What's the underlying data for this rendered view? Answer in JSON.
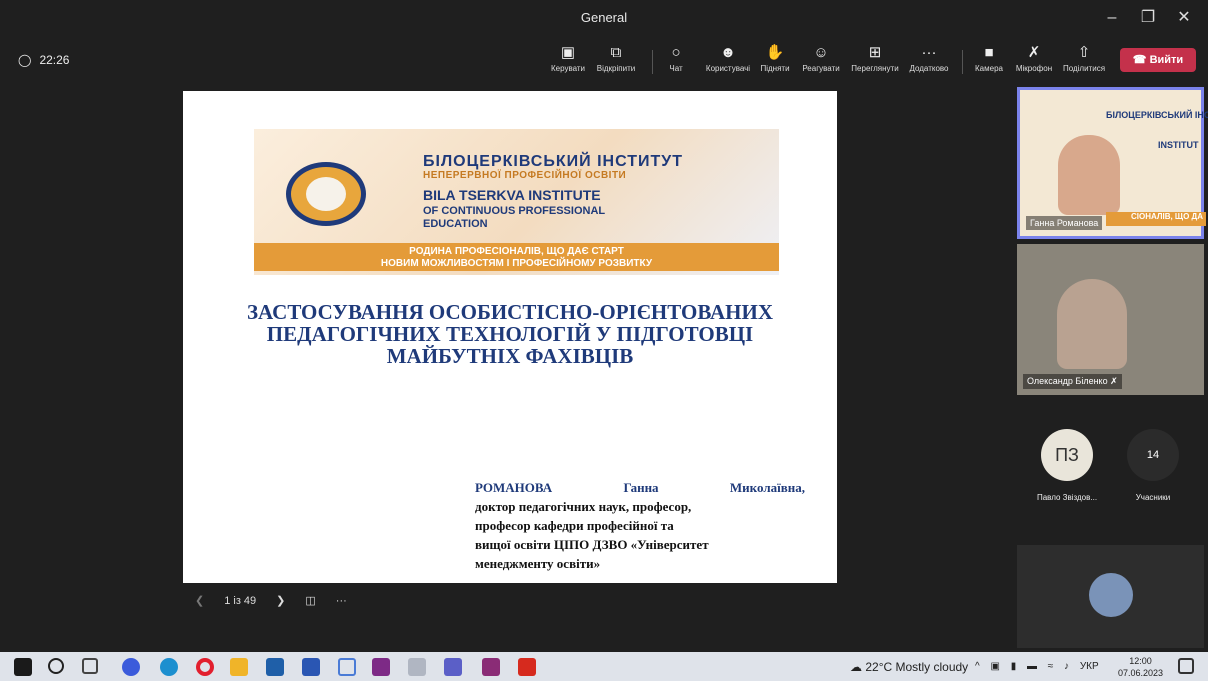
{
  "window": {
    "title": "General"
  },
  "meeting": {
    "timer": "22:26"
  },
  "toolbar": {
    "manage": "Керувати",
    "popout": "Відкріпити",
    "chat": "Чат",
    "users": "Користувачі",
    "raise": "Підняти",
    "react": "Реагувати",
    "view": "Переглянути",
    "more": "Додатково",
    "camera": "Камера",
    "mic": "Мікрофон",
    "share": "Поділитися",
    "leave": "Вийти"
  },
  "slide": {
    "banner": {
      "line1": "БІЛОЦЕРКІВСЬКИЙ ІНСТИТУТ",
      "line2": "НЕПЕРЕРВНОЇ ПРОФЕСІЙНОЇ ОСВІТИ",
      "line3": "BILA TSERKVA INSTITUTE",
      "line4": "OF CONTINUOUS PROFESSIONAL",
      "line5": "EDUCATION",
      "slogan1": "РОДИНА ПРОФЕСІОНАЛІВ, ЩО ДАЄ СТАРТ",
      "slogan2": "НОВИМ МОЖЛИВОСТЯМ І ПРОФЕСІЙНОМУ РОЗВИТКУ"
    },
    "heading1": "ЗАСТОСУВАННЯ ОСОБИСТІСНО-ОРІЄНТОВАНИХ",
    "heading2": "ПЕДАГОГІЧНИХ ТЕХНОЛОГІЙ У ПІДГОТОВЦІ",
    "heading3": "МАЙБУТНІХ ФАХІВЦІВ",
    "author_surname": "РОМАНОВА",
    "author_name": "Ганна",
    "author_patronymic": "Миколаївна,",
    "author_line2": "доктор педагогічних наук, професор,",
    "author_line3": "професор кафедри професійної та",
    "author_line4": "вищої освіти ЦІПО ДЗВО «Університет",
    "author_line5": "менеджменту освіти»"
  },
  "pager": {
    "label": "1 із 49"
  },
  "participants": {
    "p1": "Ганна Романова",
    "p2": "Олександр Біленко",
    "p3_initials": "ПЗ",
    "p3_name": "Павло Звіздов...",
    "count": "14",
    "count_label": "Учасники",
    "tile1_text1": "БІЛОЦЕРКІВСЬКИЙ ІНСТІ",
    "tile1_text2": "INSTITUT",
    "tile1_text3": "СІОНАЛІВ, ЩО ДА"
  },
  "taskbar": {
    "weather": "22°C  Mostly cloudy",
    "lang": "УКР",
    "time": "12:00",
    "date": "07.06.2023"
  },
  "colors": {
    "accent": "#c4314b",
    "slide_blue": "#1f3a7a",
    "banner_orange": "#e49b39"
  }
}
